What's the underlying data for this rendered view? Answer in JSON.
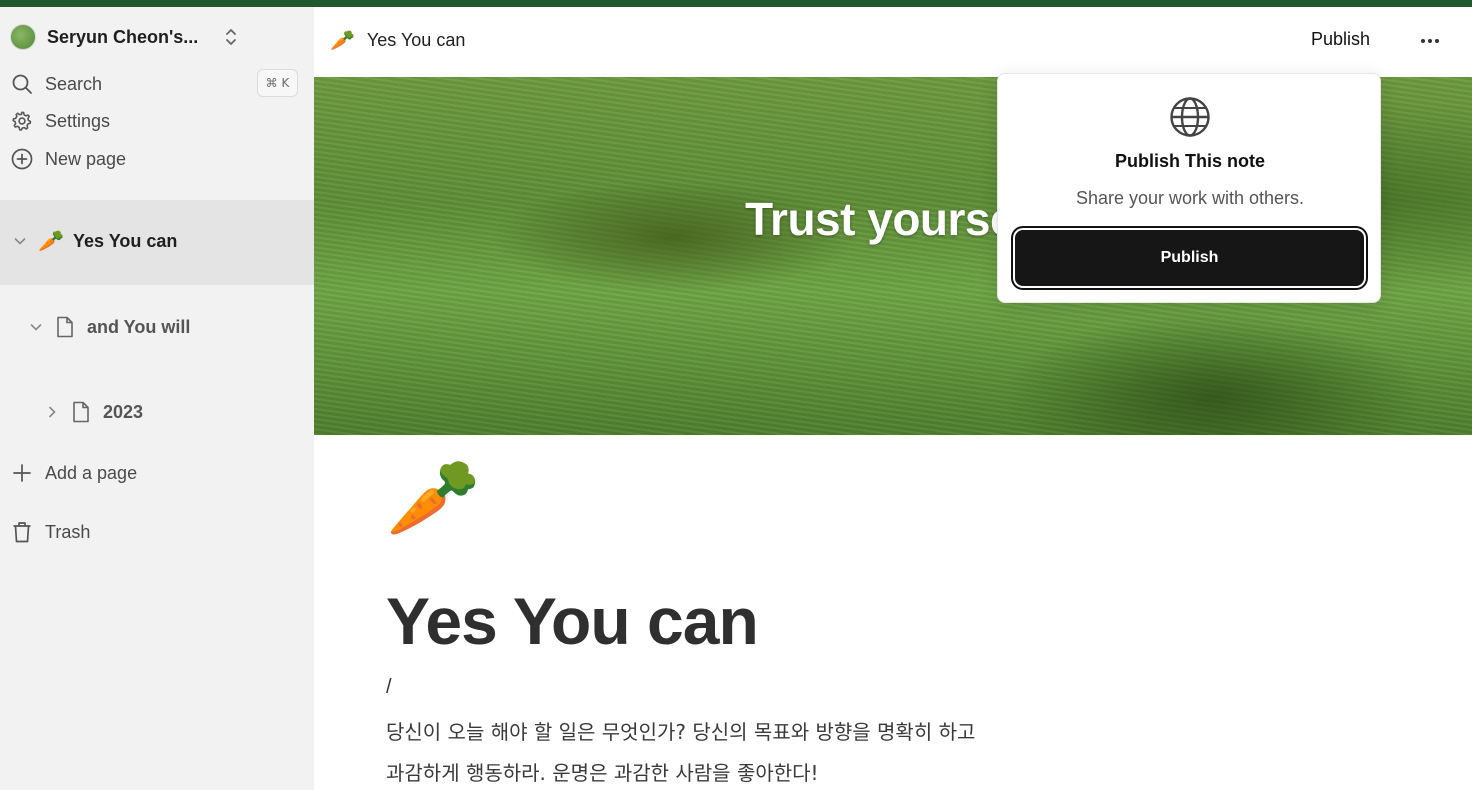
{
  "sidebar": {
    "workspace_name": "Seryun Cheon's...",
    "search_label": "Search",
    "search_shortcut": "⌘ K",
    "settings_label": "Settings",
    "new_page_label": "New page",
    "tree": [
      {
        "emoji": "🥕",
        "label": "Yes You can"
      },
      {
        "label": "and You will"
      },
      {
        "label": "2023"
      }
    ],
    "add_page_label": "Add a page",
    "trash_label": "Trash"
  },
  "topbar": {
    "emoji": "🥕",
    "title": "Yes You can",
    "publish_label": "Publish"
  },
  "cover": {
    "text": "Trust yourself"
  },
  "page": {
    "emoji": "🥕",
    "title": "Yes You can",
    "slash": "/",
    "lines": [
      "당신이 오늘 해야 할 일은 무엇인가? 당신의 목표와 방향을 명확히 하고",
      "과감하게 행동하라. 운명은 과감한 사람을 좋아한다!"
    ]
  },
  "popover": {
    "title": "Publish This note",
    "subtitle": "Share your work with others.",
    "button_label": "Publish"
  },
  "colors": {
    "accent_strip": "#1f5a2c",
    "sidebar_bg": "#f2f2f2",
    "button_dark": "#161616"
  }
}
